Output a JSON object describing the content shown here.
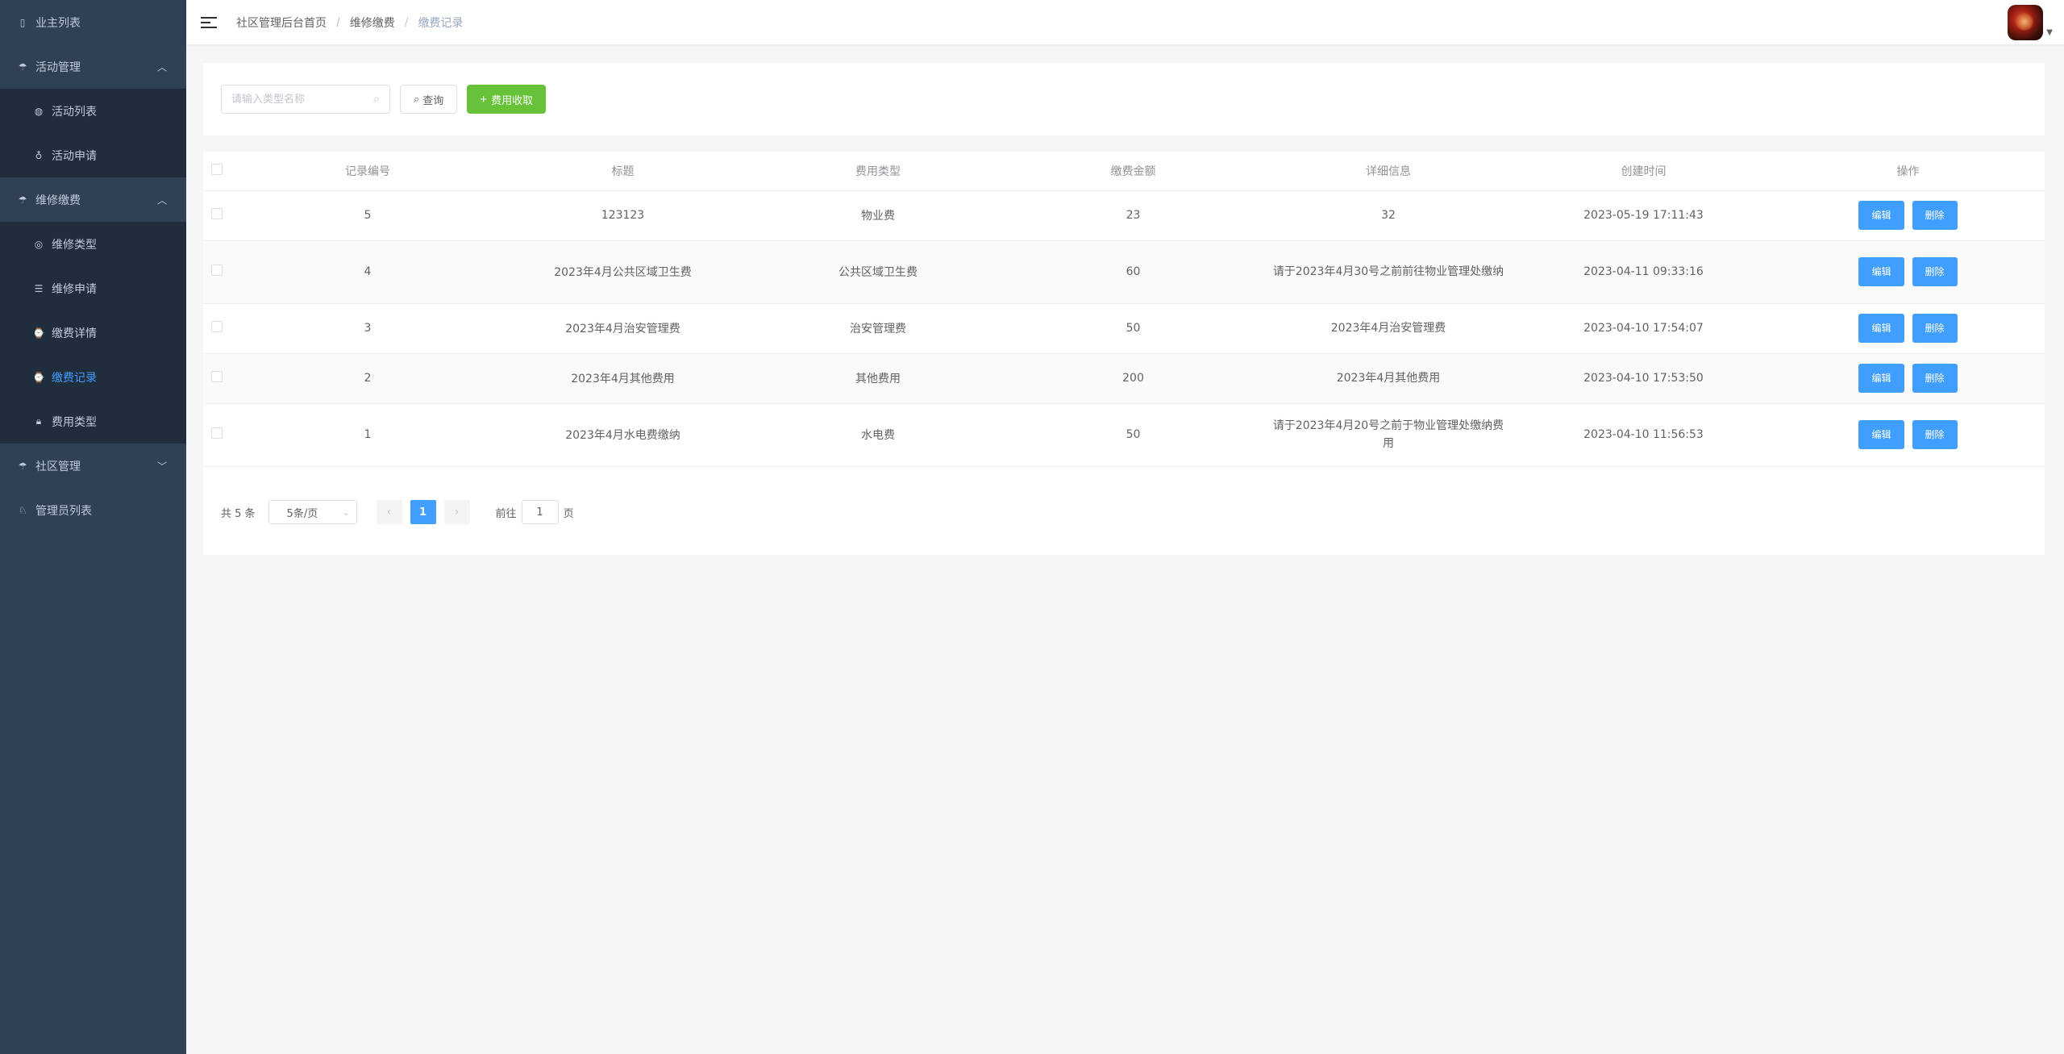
{
  "sidebar": {
    "items": [
      {
        "label": "业主列表",
        "icon": "tablet-icon"
      },
      {
        "label": "活动管理",
        "icon": "umbrella-icon",
        "expanded": true
      },
      {
        "label": "活动列表",
        "icon": "basketball-icon"
      },
      {
        "label": "活动申请",
        "icon": "medal-icon"
      },
      {
        "label": "维修缴费",
        "icon": "umbrella-icon",
        "expanded": true
      },
      {
        "label": "维修类型",
        "icon": "aim-icon"
      },
      {
        "label": "维修申请",
        "icon": "sliders-icon"
      },
      {
        "label": "缴费详情",
        "icon": "watch-icon"
      },
      {
        "label": "缴费记录",
        "icon": "watch-icon",
        "active": true
      },
      {
        "label": "费用类型",
        "icon": "lock-icon"
      },
      {
        "label": "社区管理",
        "icon": "umbrella-icon",
        "expanded": false
      },
      {
        "label": "管理员列表",
        "icon": "price-tag-icon"
      }
    ]
  },
  "header": {
    "breadcrumb": [
      "社区管理后台首页",
      "维修缴费",
      "缴费记录"
    ],
    "separator": "/"
  },
  "search": {
    "placeholder": "请输入类型名称",
    "query_label": "查询",
    "fee_label": "费用收取"
  },
  "table": {
    "columns": [
      "记录编号",
      "标题",
      "费用类型",
      "缴费金额",
      "详细信息",
      "创建时间",
      "操作"
    ],
    "edit_label": "编辑",
    "delete_label": "删除",
    "rows": [
      {
        "id": "5",
        "title": "123123",
        "type": "物业费",
        "amount": "23",
        "detail": "32",
        "created": "2023-05-19 17:11:43"
      },
      {
        "id": "4",
        "title": "2023年4月公共区域卫生费",
        "type": "公共区域卫生费",
        "amount": "60",
        "detail": "请于2023年4月30号之前前往物业管理处缴纳",
        "created": "2023-04-11 09:33:16"
      },
      {
        "id": "3",
        "title": "2023年4月治安管理费",
        "type": "治安管理费",
        "amount": "50",
        "detail": "2023年4月治安管理费",
        "created": "2023-04-10 17:54:07"
      },
      {
        "id": "2",
        "title": "2023年4月其他费用",
        "type": "其他费用",
        "amount": "200",
        "detail": "2023年4月其他费用",
        "created": "2023-04-10 17:53:50"
      },
      {
        "id": "1",
        "title": "2023年4月水电费缴纳",
        "type": "水电费",
        "amount": "50",
        "detail": "请于2023年4月20号之前于物业管理处缴纳费用",
        "created": "2023-04-10 11:56:53"
      }
    ]
  },
  "pagination": {
    "total_label": "共 5 条",
    "page_size": "5条/页",
    "current_page": "1",
    "goto_prefix": "前往",
    "goto_value": "1",
    "goto_suffix": "页"
  },
  "colors": {
    "sidebar_bg": "#304156",
    "submenu_bg": "#1f2d3d",
    "primary": "#409eff",
    "success": "#67c23a"
  }
}
